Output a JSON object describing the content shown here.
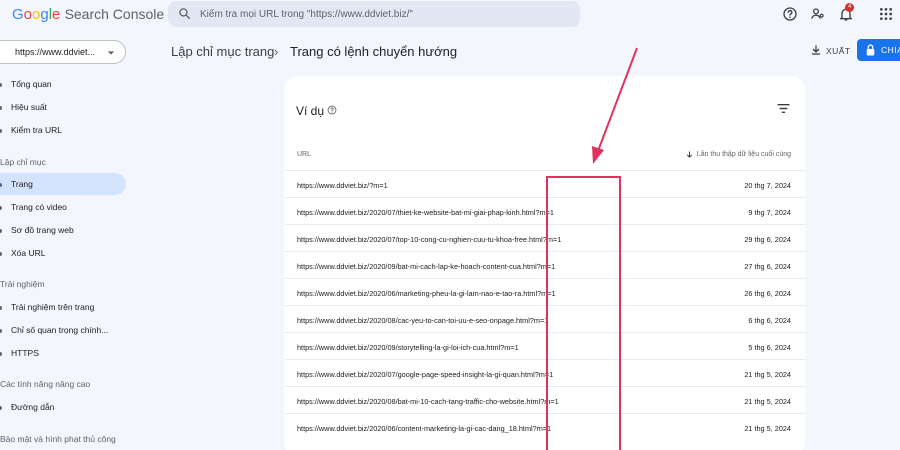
{
  "header": {
    "logo_google": "Google",
    "logo_product": "Search Console",
    "search_placeholder": "Kiểm tra mọi URL trong \"https://www.ddviet.biz/\"",
    "notification_count": "4",
    "icons": [
      "search-icon",
      "help-icon",
      "users-icon",
      "bell-icon",
      "apps-icon"
    ]
  },
  "sidebar": {
    "property": "https://www.ddviet...",
    "items": [
      {
        "label": "Tổng quan"
      },
      {
        "label": "Hiệu suất"
      },
      {
        "label": "Kiểm tra URL"
      }
    ],
    "section_indexing": "Lập chỉ mục",
    "indexing_items": [
      {
        "label": "Trang"
      },
      {
        "label": "Trang có video"
      },
      {
        "label": "Sơ đồ trang web"
      },
      {
        "label": "Xóa URL"
      }
    ],
    "section_experience": "Trải nghiệm",
    "experience_items": [
      {
        "label": "Trải nghiệm trên trang"
      },
      {
        "label": "Chỉ số quan trọng chính..."
      },
      {
        "label": "HTTPS"
      }
    ],
    "section_advanced": "Các tính năng nâng cao",
    "advanced_items": [
      {
        "label": "Đường dẫn"
      }
    ],
    "section_security": "Bảo mật và hình phạt thủ công"
  },
  "breadcrumb": {
    "parent": "Lập chỉ mục trang",
    "current": "Trang có lệnh chuyển hướng"
  },
  "toolbar": {
    "export_label": "XUẤT",
    "share_label": "CHIA"
  },
  "card": {
    "title": "Ví dụ",
    "col_url": "URL",
    "col_date": "Lần thu thập dữ liệu cuối cùng",
    "rows": [
      {
        "url": "https://www.ddviet.biz/?m=1",
        "date": "20 thg 7, 2024"
      },
      {
        "url": "https://www.ddviet.biz/2020/07/thiet-ke-website-bat-mi-giai-phap-kinh.html?m=1",
        "date": "9 thg 7, 2024"
      },
      {
        "url": "https://www.ddviet.biz/2020/07/top-10-cong-cu-nghien-cuu-tu-khoa-free.html?m=1",
        "date": "29 thg 6, 2024"
      },
      {
        "url": "https://www.ddviet.biz/2020/09/bat-mi-cach-lap-ke-hoach-content-cua.html?m=1",
        "date": "27 thg 6, 2024"
      },
      {
        "url": "https://www.ddviet.biz/2020/06/marketing-pheu-la-gi-lam-nao-e-tao-ra.html?m=1",
        "date": "26 thg 6, 2024"
      },
      {
        "url": "https://www.ddviet.biz/2020/08/cac-yeu-to-can-toi-uu-e-seo-onpage.html?m=1",
        "date": "6 thg 6, 2024"
      },
      {
        "url": "https://www.ddviet.biz/2020/09/storytelling-la-gi-loi-ich-cua.html?m=1",
        "date": "5 thg 6, 2024"
      },
      {
        "url": "https://www.ddviet.biz/2020/07/google-page-speed-insight-la-gi-quan.html?m=1",
        "date": "21 thg 5, 2024"
      },
      {
        "url": "https://www.ddviet.biz/2020/08/bat-mi-10-cach-tang-traffic-cho-website.html?m=1",
        "date": "21 thg 5, 2024"
      },
      {
        "url": "https://www.ddviet.biz/2020/06/content-marketing-la-gi-cac-dang_18.html?m=1",
        "date": "21 thg 5, 2024"
      }
    ]
  },
  "colors": {
    "accent": "#1a73e8",
    "active_nav": "#d3e3fd",
    "annotation": "#e0325c"
  }
}
